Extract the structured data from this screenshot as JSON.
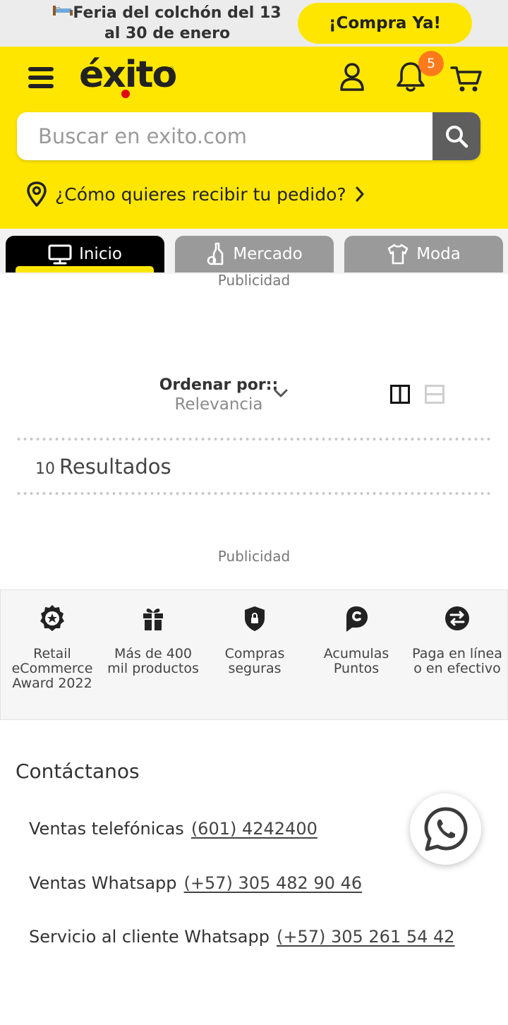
{
  "promo": {
    "text": "Feria del colchón del 13 al 30 de enero",
    "cta": "¡Compra Ya!"
  },
  "header": {
    "logo": "éxito",
    "notifications_count": "5",
    "search_placeholder": "Buscar en exito.com",
    "delivery_prompt": "¿Cómo quieres recibir tu pedido?",
    "brand_color": "#ffe600"
  },
  "tabs": [
    {
      "label": "Inicio",
      "icon": "monitor-icon",
      "active": true
    },
    {
      "label": "Mercado",
      "icon": "bottle-icon",
      "active": false
    },
    {
      "label": "Moda",
      "icon": "shirt-icon",
      "active": false
    }
  ],
  "ads": {
    "label_top": "Publicidad",
    "label_bottom": "Publicidad"
  },
  "sort": {
    "label": "Ordenar por::",
    "value": "Relevancia"
  },
  "results": {
    "count": "10",
    "label": "Resultados"
  },
  "benefits": [
    {
      "icon": "award-icon",
      "label": "Retail eCommerce Award 2022"
    },
    {
      "icon": "gift-icon",
      "label": "Más de 400 mil productos"
    },
    {
      "icon": "shield-lock-icon",
      "label": "Compras seguras"
    },
    {
      "icon": "points-icon",
      "label": "Acumulas Puntos"
    },
    {
      "icon": "exchange-icon",
      "label": "Paga en línea o en efectivo"
    }
  ],
  "contact": {
    "title": "Contáctanos",
    "rows": [
      {
        "label": "Ventas telefónicas",
        "value": "(601) 4242400"
      },
      {
        "label": "Ventas Whatsapp",
        "value": "(+57) 305 482 90 46"
      },
      {
        "label": "Servicio al cliente Whatsapp",
        "value": "(+57) 305 261 54 42"
      }
    ]
  }
}
